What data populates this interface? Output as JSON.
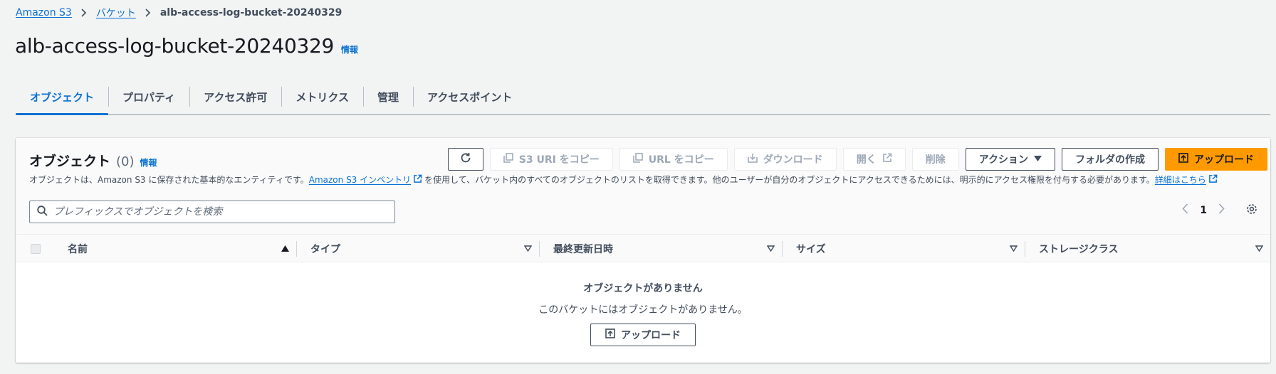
{
  "breadcrumb": {
    "root": "Amazon S3",
    "buckets": "バケット",
    "current": "alb-access-log-bucket-20240329"
  },
  "page": {
    "title": "alb-access-log-bucket-20240329",
    "info": "情報"
  },
  "tabs": [
    {
      "label": "オブジェクト",
      "active": true
    },
    {
      "label": "プロパティ"
    },
    {
      "label": "アクセス許可"
    },
    {
      "label": "メトリクス"
    },
    {
      "label": "管理"
    },
    {
      "label": "アクセスポイント"
    }
  ],
  "objects": {
    "title": "オブジェクト",
    "count": "(0)",
    "info": "情報",
    "desc_part1": "オブジェクトは、Amazon S3 に保存された基本的なエンティティです。",
    "desc_link1": "Amazon S3 インベントリ",
    "desc_part2": "を使用して、バケット内のすべてのオブジェクトのリストを取得できます。他のユーザーが自分のオブジェクトにアクセスできるためには、明示的にアクセス権限を付与する必要があります。",
    "desc_link2": "詳細はこちら",
    "actions": {
      "copy_s3_uri": "S3 URI をコピー",
      "copy_url": "URL をコピー",
      "download": "ダウンロード",
      "open": "開く",
      "delete": "削除",
      "actions": "アクション",
      "create_folder": "フォルダの作成",
      "upload": "アップロード"
    },
    "search_placeholder": "プレフィックスでオブジェクトを検索",
    "page_number": "1",
    "columns": [
      "名前",
      "タイプ",
      "最終更新日時",
      "サイズ",
      "ストレージクラス"
    ],
    "empty_title": "オブジェクトがありません",
    "empty_sub": "このバケットにはオブジェクトがありません。",
    "empty_upload": "アップロード"
  },
  "colors": {
    "accent": "#0972d3",
    "primary": "#ff9900",
    "text": "#16191f",
    "muted": "#414d5c"
  }
}
